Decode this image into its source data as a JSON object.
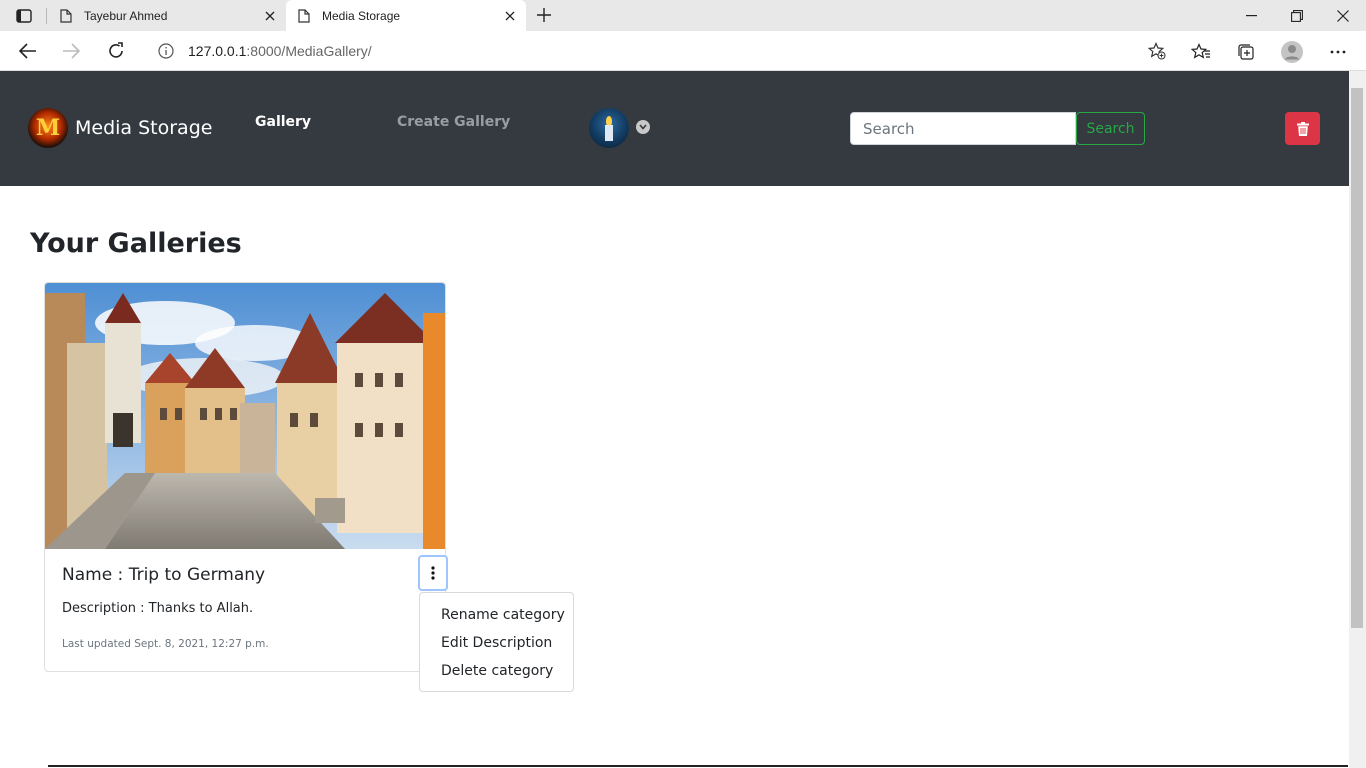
{
  "browser": {
    "tabs": [
      {
        "title": "Tayebur Ahmed",
        "active": false
      },
      {
        "title": "Media Storage",
        "active": true
      }
    ],
    "url_host": "127.0.0.1",
    "url_rest": ":8000/MediaGallery/"
  },
  "site": {
    "brand": "Media Storage",
    "brand_logo_letter": "M",
    "nav": {
      "gallery": "Gallery",
      "create_gallery": "Create Gallery"
    },
    "search": {
      "placeholder": "Search",
      "button": "Search"
    }
  },
  "main": {
    "heading": "Your Galleries",
    "galleries": [
      {
        "name": "Name : Trip to Germany",
        "description": "Description : Thanks to Allah.",
        "updated": "Last updated Sept. 8, 2021, 12:27 p.m."
      }
    ],
    "menu": {
      "items": [
        "Rename category",
        "Edit Description",
        "Delete category"
      ]
    }
  },
  "colors": {
    "navbar_bg": "#343a40",
    "search_green": "#28a745",
    "danger_red": "#dc3545"
  },
  "icons": [
    "sidebar-icon",
    "page-icon",
    "close-icon",
    "plus-icon",
    "minimize-icon",
    "restore-icon",
    "back-icon",
    "forward-icon",
    "refresh-icon",
    "info-icon",
    "favorite-add-icon",
    "favorites-icon",
    "collections-icon",
    "profile-icon",
    "more-icon",
    "caret-down-icon",
    "trash-icon",
    "kebab-icon"
  ]
}
